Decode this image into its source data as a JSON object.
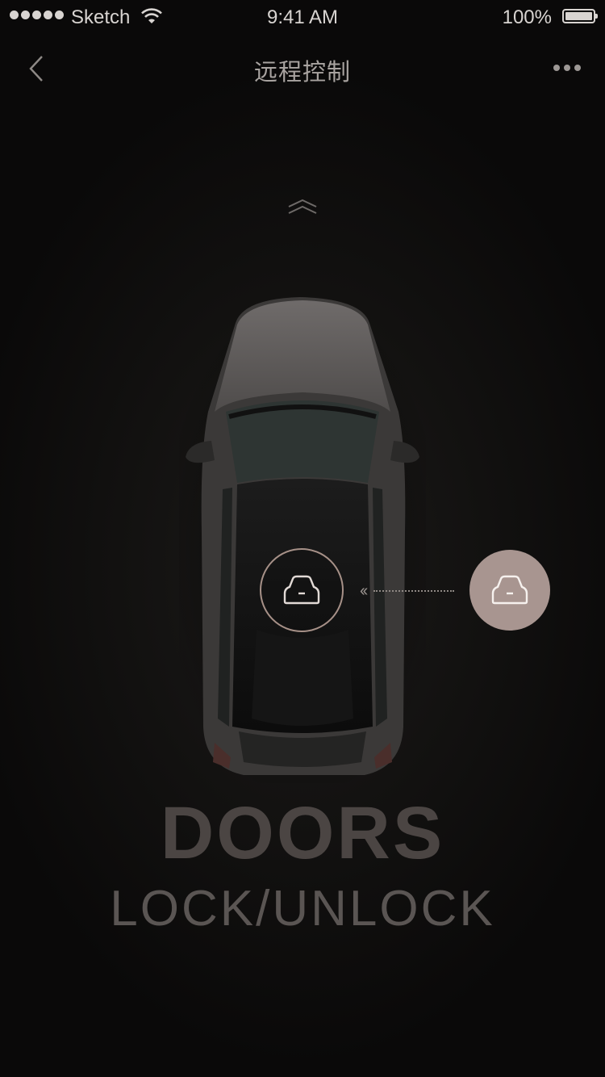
{
  "status_bar": {
    "carrier": "Sketch",
    "time": "9:41 AM",
    "battery": "100%"
  },
  "nav": {
    "title": "远程控制",
    "back_icon": "chevron-left-icon",
    "more_icon": "more-dots-icon"
  },
  "hint_icon": "chevron-up-double-icon",
  "lock_control": {
    "target_icon": "car-front-icon",
    "handle_icon": "car-front-icon",
    "arrow_text": "‹‹"
  },
  "feature": {
    "title": "DOORS",
    "subtitle": "LOCK/UNLOCK"
  },
  "colors": {
    "background": "#0d0c0c",
    "accent": "#a89590",
    "ring": "#a79188"
  }
}
